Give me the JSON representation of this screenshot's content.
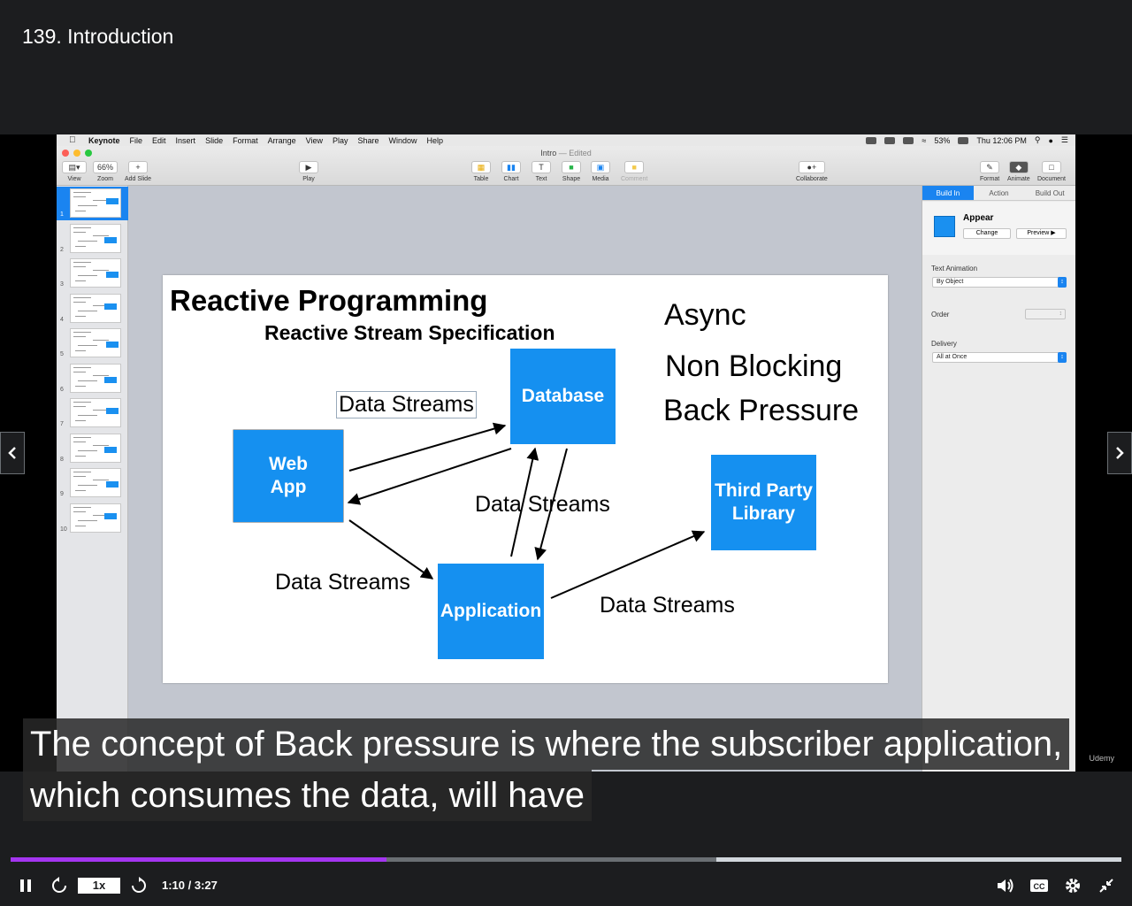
{
  "lecture": {
    "title": "139. Introduction"
  },
  "mac": {
    "menubar": {
      "app": "Keynote",
      "items": [
        "File",
        "Edit",
        "Insert",
        "Slide",
        "Format",
        "Arrange",
        "View",
        "Play",
        "Share",
        "Window",
        "Help"
      ],
      "battery": "53%",
      "clock": "Thu 12:06 PM"
    },
    "document": {
      "name": "Intro",
      "status": "— Edited"
    },
    "toolbar": {
      "view": "View",
      "zoom": "Zoom",
      "zoom_value": "66%",
      "add_slide": "Add Slide",
      "play": "Play",
      "table": "Table",
      "chart": "Chart",
      "text": "Text",
      "shape": "Shape",
      "media": "Media",
      "comment": "Comment",
      "collaborate": "Collaborate",
      "format": "Format",
      "animate": "Animate",
      "document": "Document"
    },
    "slide_numbers": [
      "1",
      "2",
      "3",
      "4",
      "5",
      "6",
      "7",
      "8",
      "9",
      "10"
    ],
    "inspector": {
      "tabs": [
        "Build In",
        "Action",
        "Build Out"
      ],
      "effect": "Appear",
      "change": "Change",
      "preview": "Preview",
      "text_animation_label": "Text Animation",
      "text_animation_value": "By Object",
      "order_label": "Order",
      "delivery_label": "Delivery",
      "delivery_value": "All at Once"
    }
  },
  "slide": {
    "title": "Reactive Programming",
    "subtitle": "Reactive Stream Specification",
    "features": [
      "Async",
      "Non Blocking",
      "Back Pressure"
    ],
    "boxes": {
      "web_app_line1": "Web",
      "web_app_line2": "App",
      "database": "Database",
      "application": "Application",
      "third_party_line1": "Third Party",
      "third_party_line2": "Library"
    },
    "labels": {
      "ds_top": "Data Streams",
      "ds_middle": "Data Streams",
      "ds_left": "Data Streams",
      "ds_right": "Data Streams"
    },
    "colors": {
      "box": "#1590f0"
    }
  },
  "captions": {
    "line1": "The concept of Back pressure is where the subscriber application,",
    "line2": "which consumes the data, will have"
  },
  "watermark": "Udemy",
  "player": {
    "speed": "1x",
    "time": "1:10 / 3:27",
    "progress_fraction": 0.338,
    "buffered_fraction": 0.635,
    "accent": "#a435f0"
  }
}
